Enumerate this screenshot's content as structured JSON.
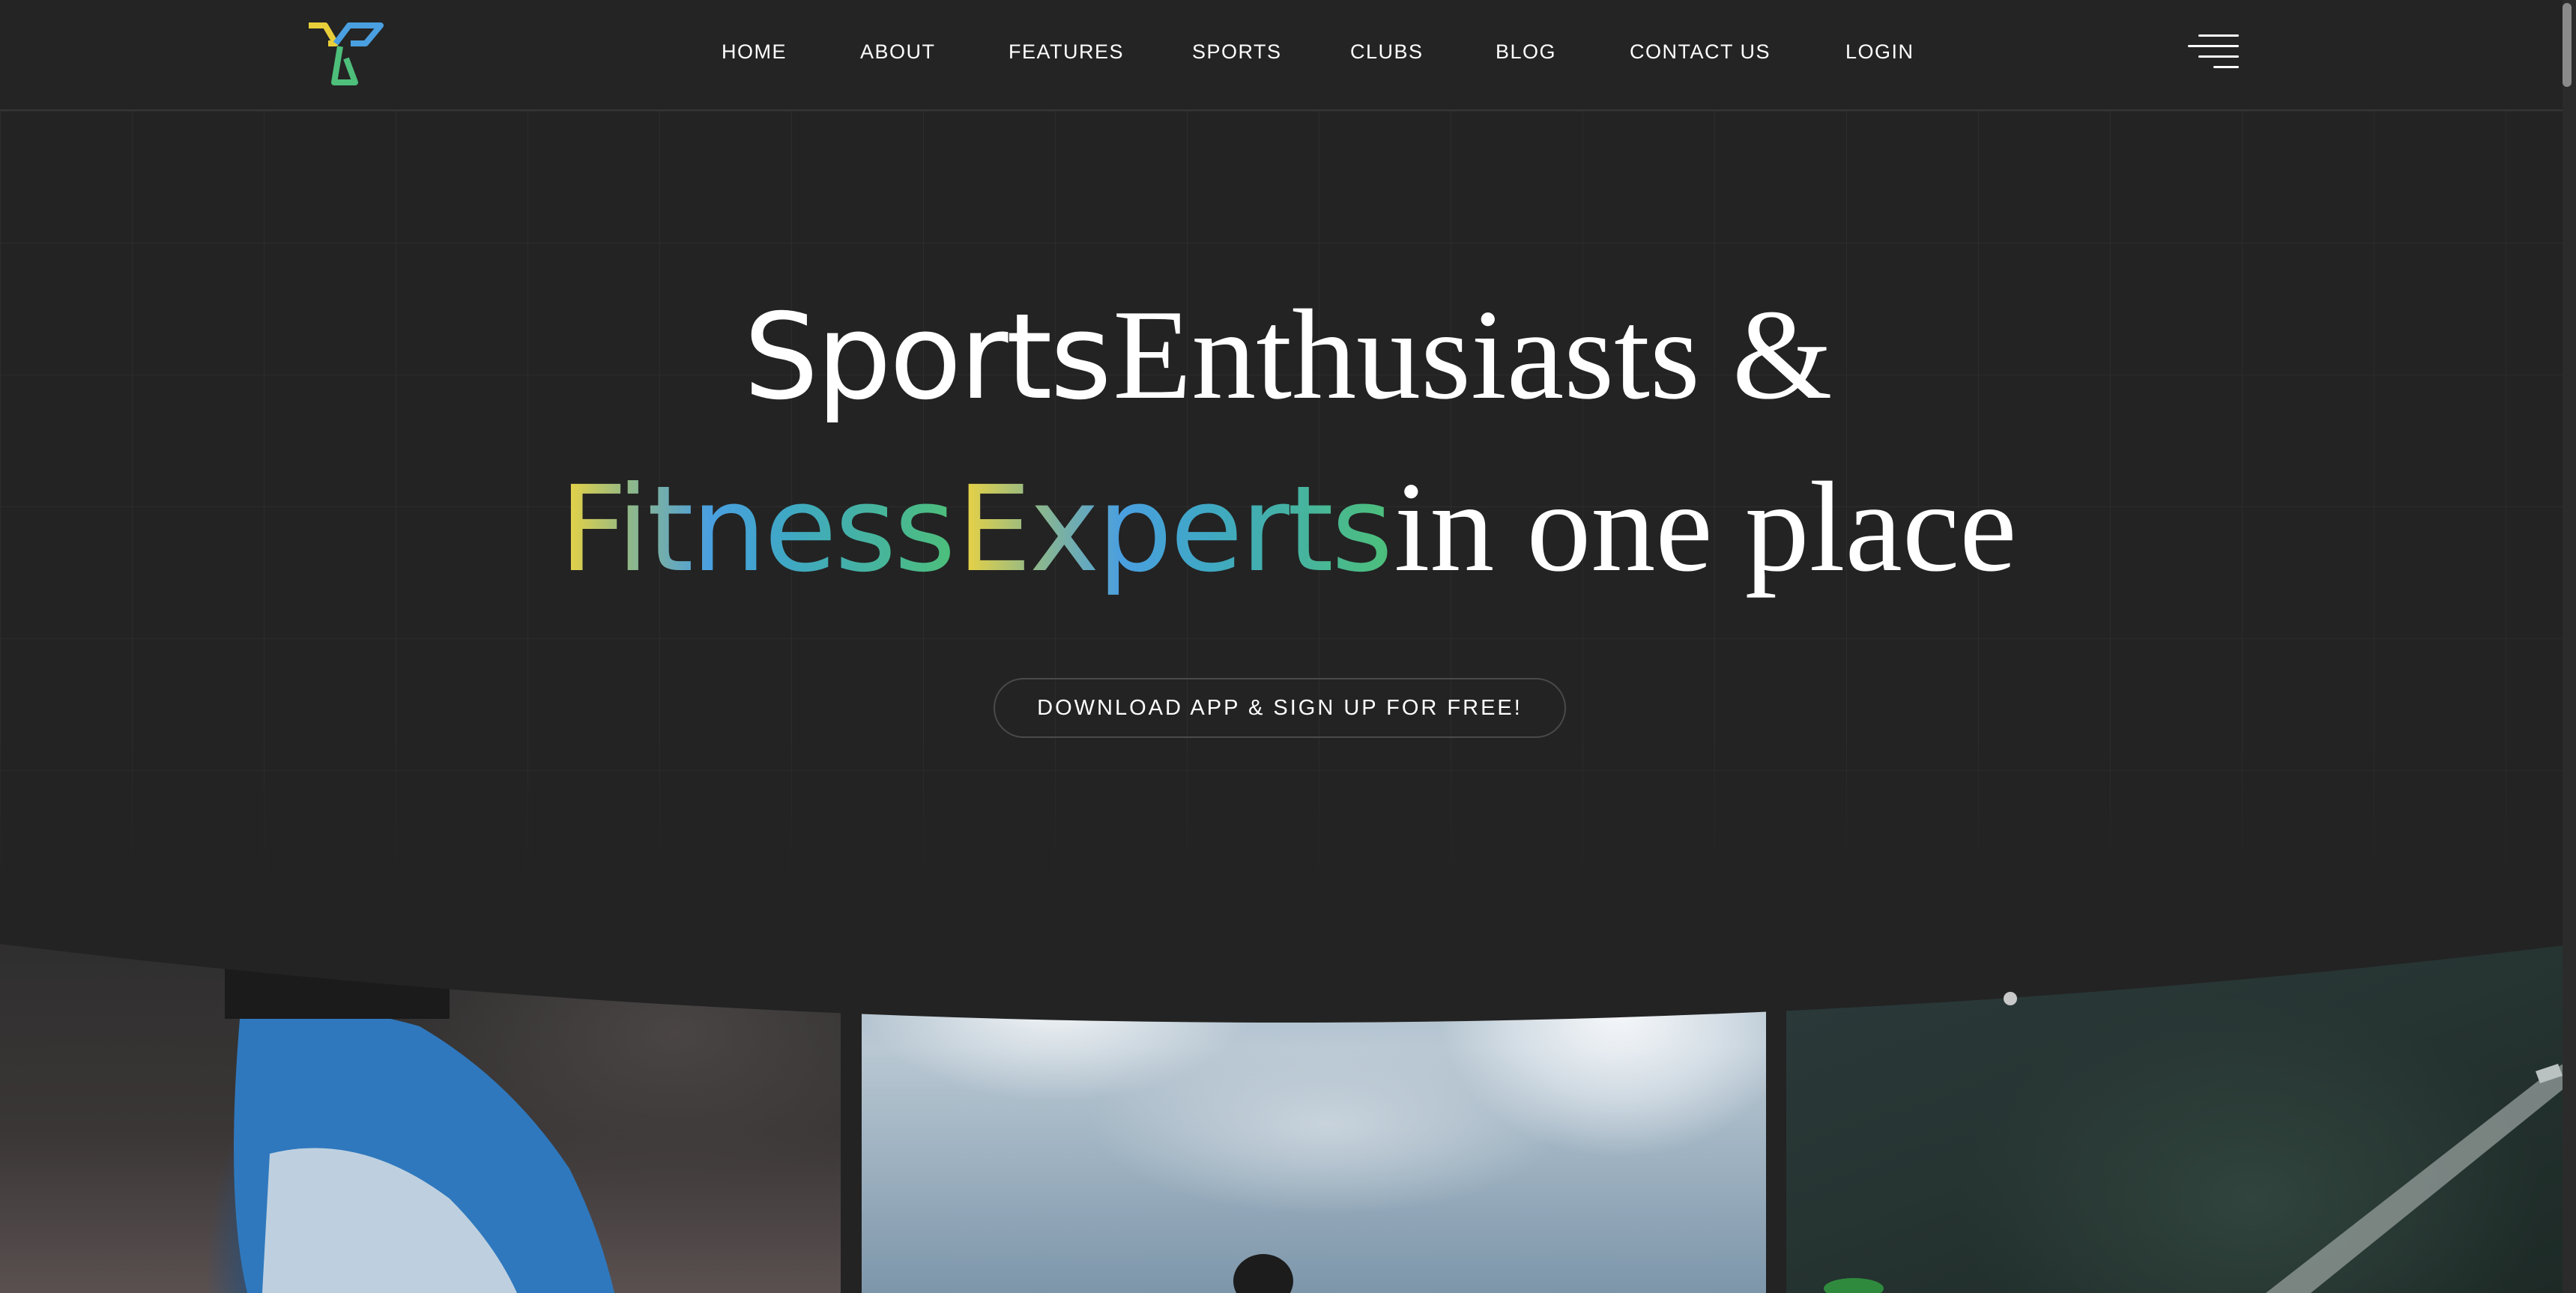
{
  "header": {
    "logo_icon": "y-logo-icon",
    "nav": [
      {
        "label": "HOME"
      },
      {
        "label": "ABOUT"
      },
      {
        "label": "FEATURES"
      },
      {
        "label": "SPORTS"
      },
      {
        "label": "CLUBS"
      },
      {
        "label": "BLOG"
      },
      {
        "label": "CONTACT US"
      },
      {
        "label": "LOGIN"
      }
    ],
    "menu_icon": "hamburger-menu-icon"
  },
  "hero": {
    "line1_sans": "Sports",
    "line1_serif": "Enthusiasts &",
    "line2_gradient_1": "Fitness",
    "line2_gradient_2": "Experts",
    "line2_serif": "in one place",
    "cta_label": "DOWNLOAD APP & SIGN UP FOR FREE!",
    "gradient_colors": [
      "#f2d53c",
      "#4a9fe0",
      "#4dbf7a"
    ]
  },
  "photos": [
    {
      "subject": "football-boot-photo"
    },
    {
      "subject": "sky-athlete-photo"
    },
    {
      "subject": "tennis-court-photo"
    }
  ],
  "colors": {
    "background": "#232323",
    "text": "#ffffff",
    "cta_border": "#4a4a4a"
  }
}
